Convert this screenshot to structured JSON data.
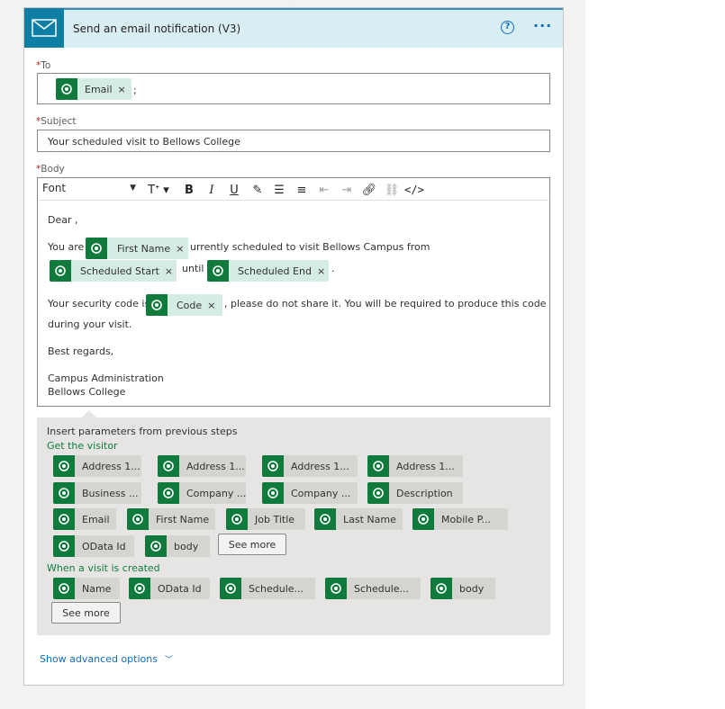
{
  "card": {
    "title": "Send an email notification (V3)"
  },
  "to": {
    "label": "To",
    "required_mark": "*",
    "token": "Email",
    "separator": ";"
  },
  "subject": {
    "label": "Subject",
    "required_mark": "*",
    "value": "Your scheduled visit to Bellows College"
  },
  "body": {
    "label": "Body",
    "required_mark": "*",
    "font": "Font",
    "line_dear": "Dear ,",
    "you_are": "You are",
    "token_first_name": "First Name",
    "after_first": "urrently scheduled to visit Bellows Campus from",
    "token_start": "Scheduled Start",
    "until": "until",
    "token_end": "Scheduled End",
    "period": ".",
    "code_pre": "Your security code is",
    "token_code": "Code",
    "code_post": ", please do not share it. You will be required to produce this code",
    "code_line2": "during your visit.",
    "regards": "Best regards,",
    "sig1": "Campus Administration",
    "sig2": "Bellows College"
  },
  "params": {
    "title": "Insert parameters from previous steps",
    "group1": "Get the visitor",
    "group1_items": [
      "Address 1...",
      "Address 1...",
      "Address 1...",
      "Address 1...",
      "Business ...",
      "Company ...",
      "Company ...",
      "Description",
      "Email",
      "First Name",
      "Job Title",
      "Last Name",
      "Mobile P...",
      "OData Id",
      "body"
    ],
    "see_more": "See more",
    "group2": "When a visit is created",
    "group2_items": [
      "Name",
      "OData Id",
      "Schedule...",
      "Schedule...",
      "body"
    ]
  },
  "advanced": "Show advanced options",
  "colors": {
    "accent_blue": "#0f6cbd",
    "dataverse_green": "#0f7a3c",
    "header_bg": "#d9eef3"
  }
}
